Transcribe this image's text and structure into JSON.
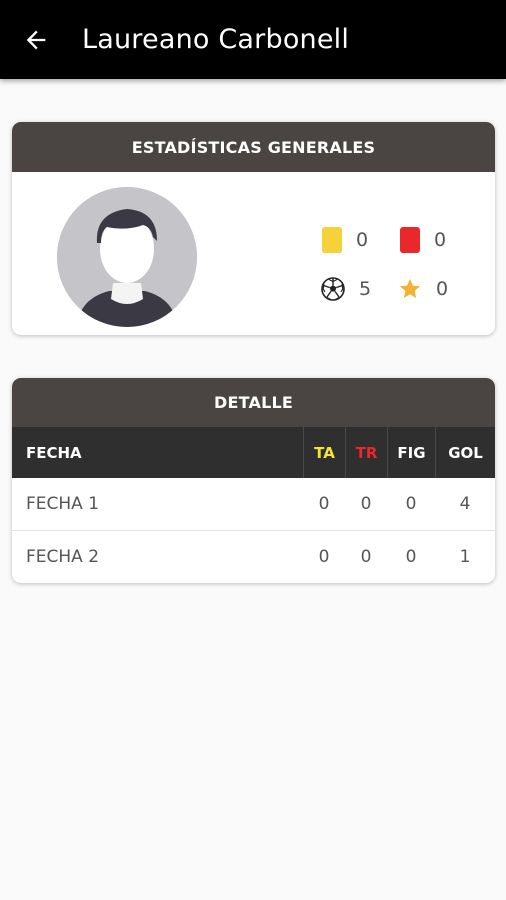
{
  "appbar": {
    "title": "Laureano Carbonell",
    "back_icon": "arrow-left-icon"
  },
  "general_stats": {
    "header": "ESTADÍSTICAS GENERALES",
    "yellow_cards": "0",
    "red_cards": "0",
    "goals": "5",
    "figure": "0",
    "colors": {
      "yellow": "#f5d23a",
      "red": "#e8282b",
      "star": "#f2b233"
    }
  },
  "detail": {
    "header": "DETALLE",
    "columns": {
      "fecha": "FECHA",
      "ta": "TA",
      "tr": "TR",
      "fig": "FIG",
      "gol": "GOL"
    },
    "column_colors": {
      "ta": "#f5e33a",
      "tr": "#e8282b"
    },
    "rows": [
      {
        "fecha": "FECHA 1",
        "ta": "0",
        "tr": "0",
        "fig": "0",
        "gol": "4"
      },
      {
        "fecha": "FECHA 2",
        "ta": "0",
        "tr": "0",
        "fig": "0",
        "gol": "1"
      }
    ]
  }
}
